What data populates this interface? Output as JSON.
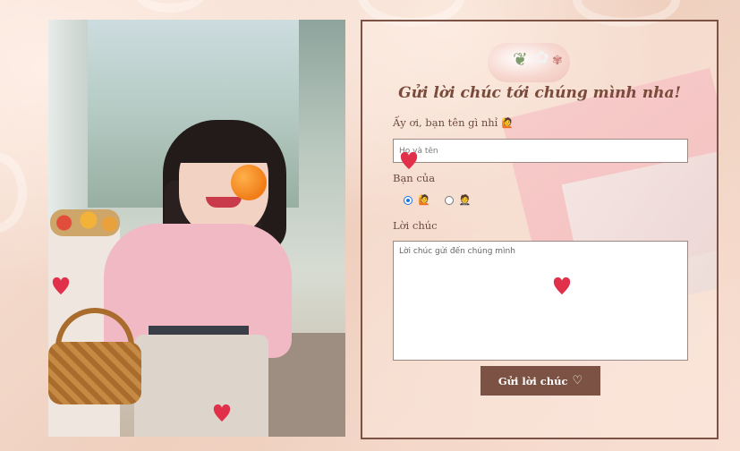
{
  "form": {
    "title": "Gửi lời chúc tới chúng mình nha!",
    "name_label": "Ấy ơi, bạn tên gì nhỉ",
    "name_label_icon": "🙋",
    "name_placeholder": "Họ và tên",
    "relation_label": "Bạn của",
    "relation_options": [
      {
        "icon": "🙋",
        "checked": true
      },
      {
        "icon": "🤵",
        "checked": false
      }
    ],
    "message_label": "Lời chúc",
    "message_placeholder": "Lời chúc gửi đến chúng mình",
    "submit_label": "Gửi lời chúc",
    "submit_icon": "♡"
  },
  "colors": {
    "accent": "#7b5243",
    "heart": "#e0304a",
    "title": "#7a4a3a"
  }
}
